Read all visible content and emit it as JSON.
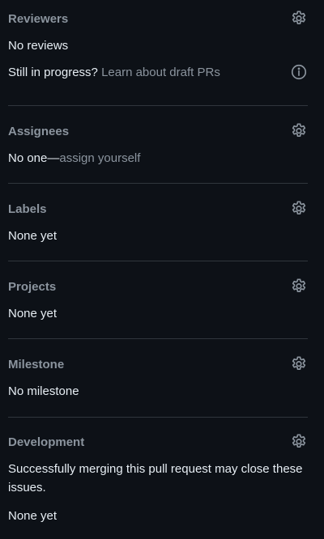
{
  "reviewers": {
    "title": "Reviewers",
    "value": "No reviews",
    "draft_prefix": "Still in progress?",
    "draft_link": "Learn about draft PRs"
  },
  "assignees": {
    "title": "Assignees",
    "value_prefix": "No one—",
    "assign_link": "assign yourself"
  },
  "labels": {
    "title": "Labels",
    "value": "None yet"
  },
  "projects": {
    "title": "Projects",
    "value": "None yet"
  },
  "milestone": {
    "title": "Milestone",
    "value": "No milestone"
  },
  "development": {
    "title": "Development",
    "description": "Successfully merging this pull request may close these issues.",
    "value": "None yet"
  },
  "icons": {
    "settings": "gear-icon",
    "info": "info-icon"
  },
  "colors": {
    "background": "#0d1117",
    "heading": "#8b949e",
    "text": "#e6edf3",
    "divider": "#30363d"
  }
}
